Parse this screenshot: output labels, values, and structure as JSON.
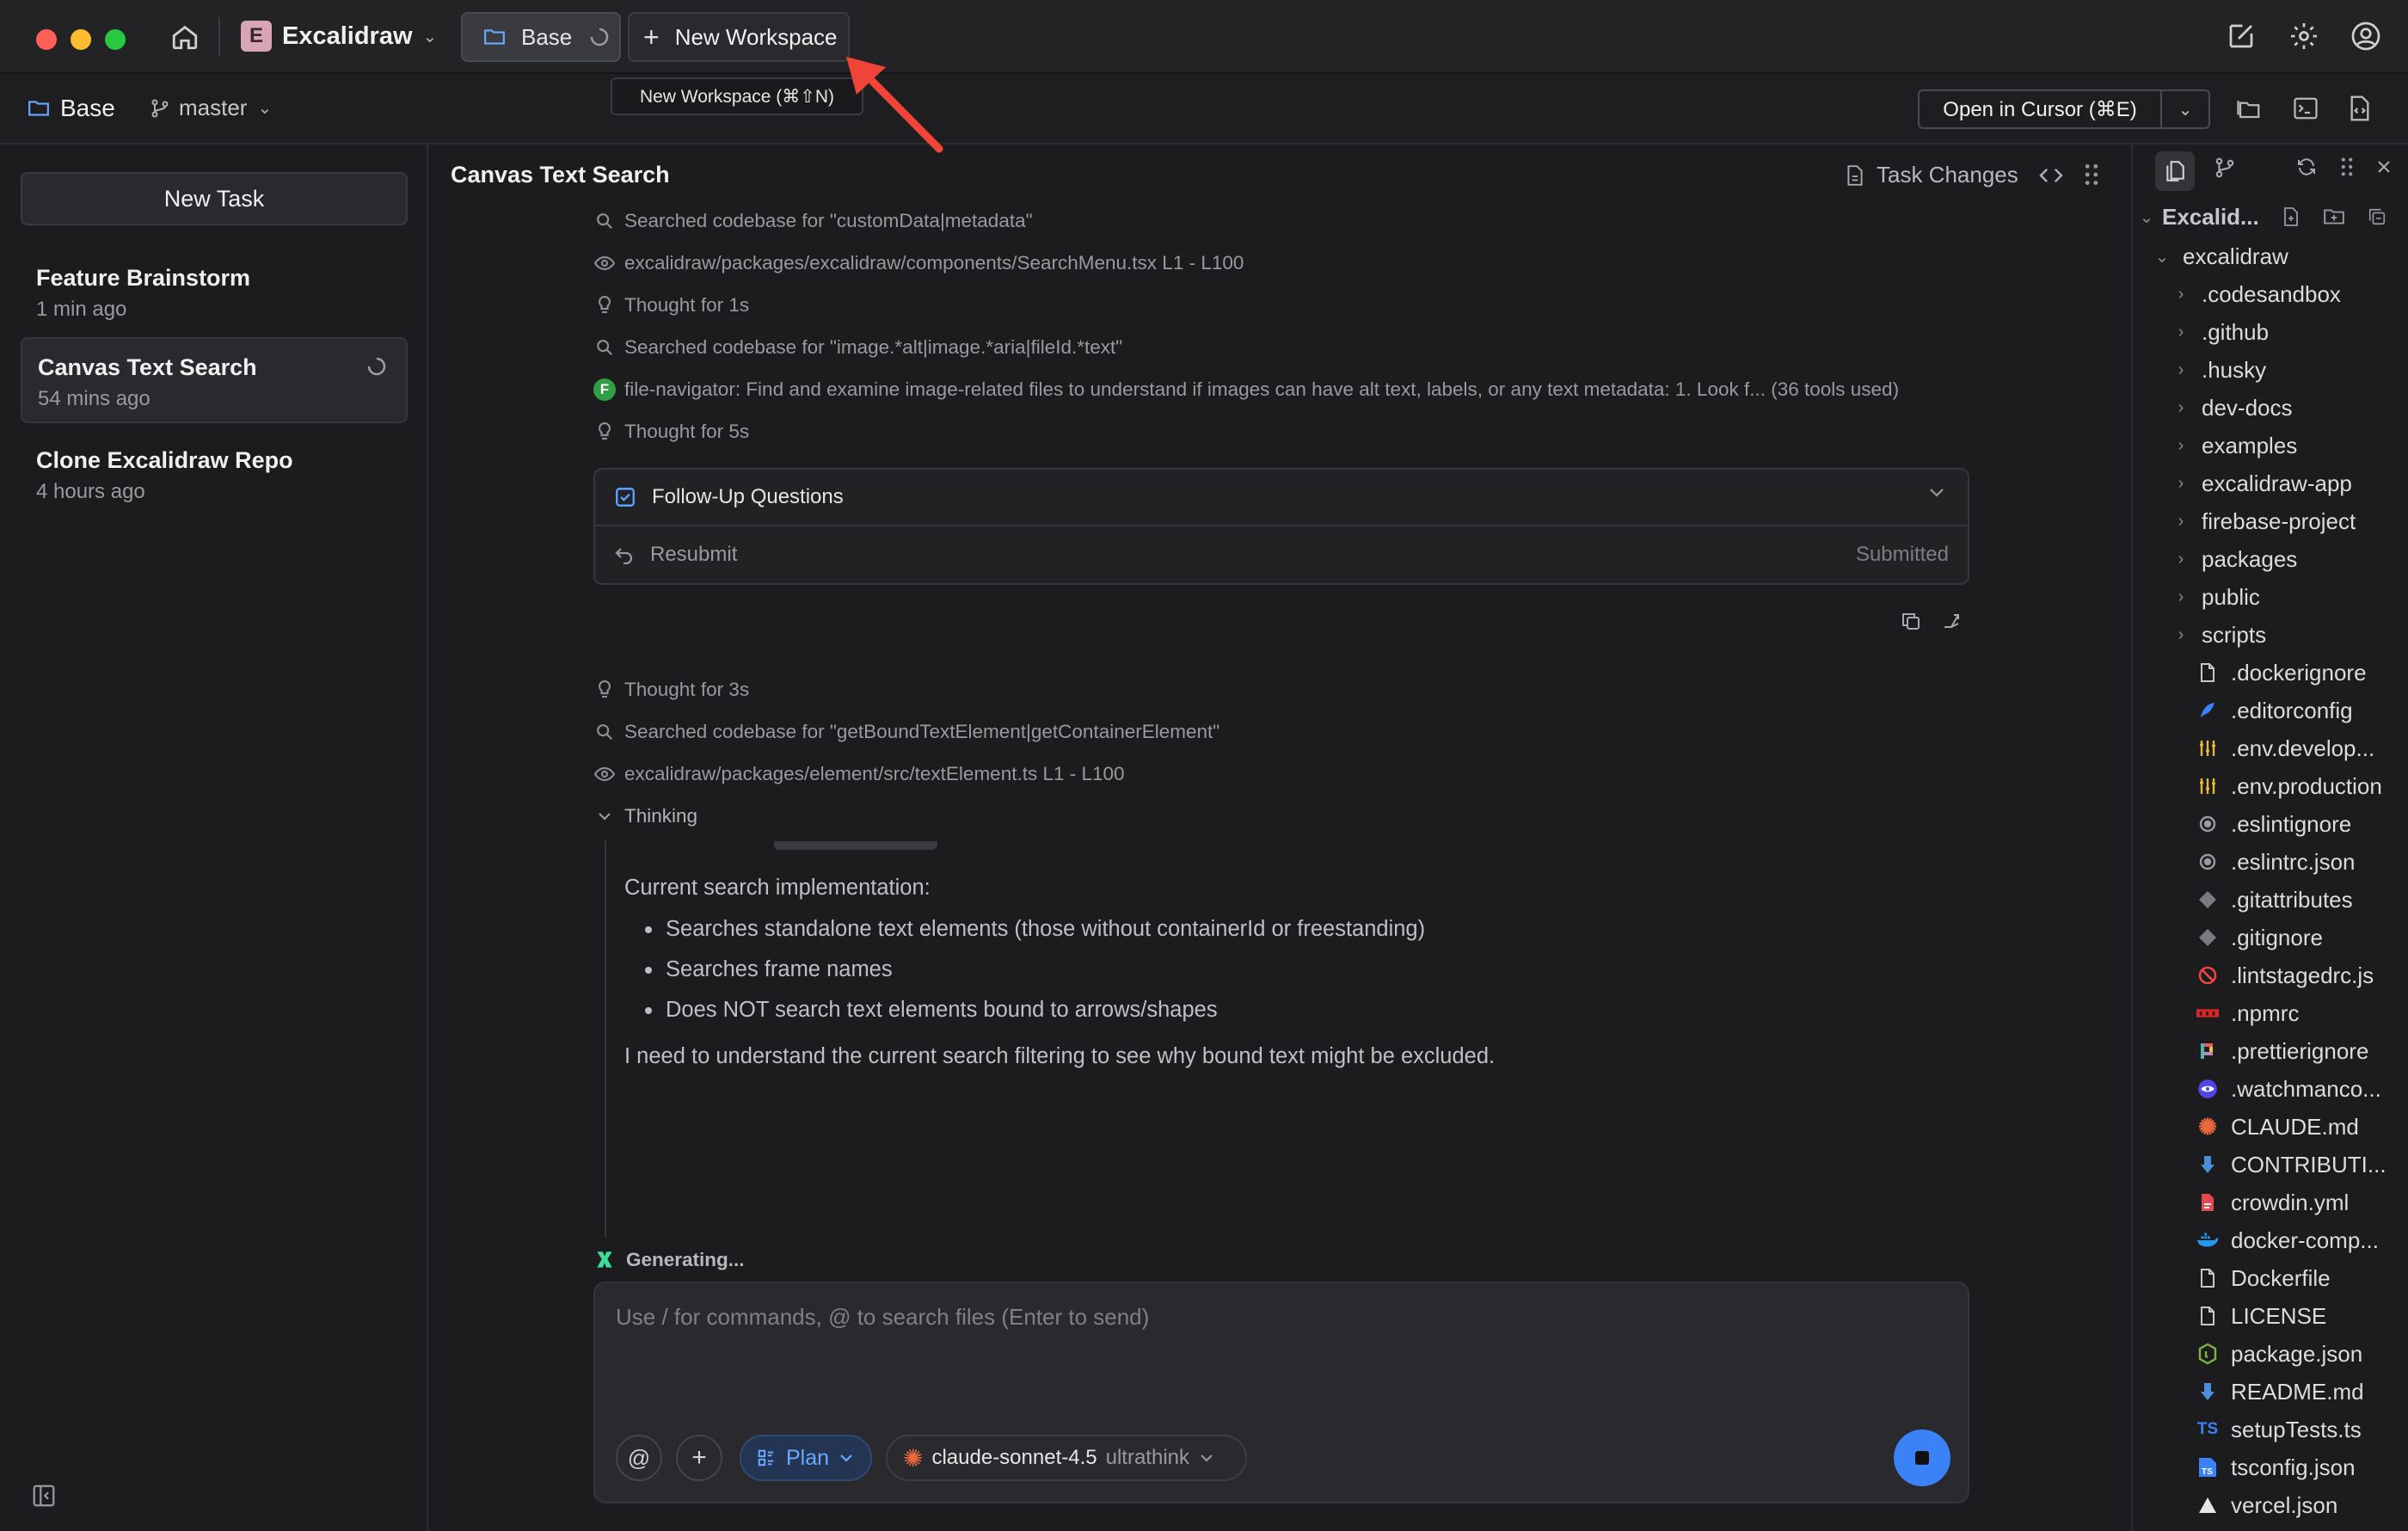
{
  "titlebar": {
    "app_name": "Excalidraw",
    "app_initial": "E",
    "tab_base": "Base",
    "new_workspace": "New Workspace",
    "tooltip": "New Workspace (⌘⇧N)"
  },
  "bar2": {
    "workspace": "Base",
    "branch": "master",
    "open_in_cursor": "Open in Cursor (⌘E)"
  },
  "sidebar": {
    "new_task": "New Task",
    "tasks": [
      {
        "title": "Feature Brainstorm",
        "time": "1 min ago"
      },
      {
        "title": "Canvas Text Search",
        "time": "54 mins ago"
      },
      {
        "title": "Clone Excalidraw Repo",
        "time": "4 hours ago"
      }
    ]
  },
  "main": {
    "title": "Canvas Text Search",
    "task_changes": "Task Changes",
    "lines_top": [
      "Searched codebase for \"customData|metadata\"",
      "excalidraw/packages/excalidraw/components/SearchMenu.tsx L1 - L100",
      "Thought for 1s",
      "Searched codebase for \"image.*alt|image.*aria|fileId.*text\"",
      "file-navigator: Find and examine image-related files to understand if images can have alt text, labels, or any text metadata: 1. Look f...  (36 tools used)",
      "Thought for 5s"
    ],
    "agent_badge": "F",
    "followup": "Follow-Up Questions",
    "resubmit": "Resubmit",
    "submitted": "Submitted",
    "lines_bottom": [
      "Thought for 3s",
      "Searched codebase for \"getBoundTextElement|getContainerElement\"",
      "excalidraw/packages/element/src/textElement.ts L1 - L100"
    ],
    "thinking": "Thinking",
    "thinking_heading": "Current search implementation:",
    "bullets": [
      "Searches standalone text elements (those without containerId or freestanding)",
      "Searches frame names",
      "Does NOT search text elements bound to arrows/shapes"
    ],
    "thinking_tail": "I need to understand the current search filtering to see why bound text might be excluded.",
    "generating": "Generating...",
    "input_placeholder": "Use / for commands, @ to search files (Enter to send)",
    "mode": "Plan",
    "model": "claude-sonnet-4.5",
    "model_suffix": "ultrathink"
  },
  "rpanel": {
    "project": "Excalid...",
    "root": "excalidraw",
    "folders": [
      ".codesandbox",
      ".github",
      ".husky",
      "dev-docs",
      "examples",
      "excalidraw-app",
      "firebase-project",
      "packages",
      "public",
      "scripts"
    ],
    "files": [
      {
        "name": ".dockerignore",
        "icon": "file-icon",
        "color": "#c8c8c8"
      },
      {
        "name": ".editorconfig",
        "icon": "editorconfig-icon",
        "color": "#3b82f6"
      },
      {
        "name": ".env.develop...",
        "icon": "env-icon",
        "color": "#e5b83b"
      },
      {
        "name": ".env.production",
        "icon": "env-icon",
        "color": "#e5b83b"
      },
      {
        "name": ".eslintignore",
        "icon": "eslint-icon",
        "color": "#9a9a9e"
      },
      {
        "name": ".eslintrc.json",
        "icon": "eslint-icon",
        "color": "#9a9a9e"
      },
      {
        "name": ".gitattributes",
        "icon": "git-icon",
        "color": "#7a7a80"
      },
      {
        "name": ".gitignore",
        "icon": "git-icon",
        "color": "#7a7a80"
      },
      {
        "name": ".lintstagedrc.js",
        "icon": "block-icon",
        "color": "#ef4444"
      },
      {
        "name": ".npmrc",
        "icon": "npm-icon",
        "color": "#dc2626"
      },
      {
        "name": ".prettierignore",
        "icon": "prettier-icon",
        "color": "#f59e0b"
      },
      {
        "name": ".watchmanco...",
        "icon": "watchman-icon",
        "color": "#4f46e5"
      },
      {
        "name": "CLAUDE.md",
        "icon": "claude-icon",
        "color": "#e8693c"
      },
      {
        "name": "CONTRIBUTI...",
        "icon": "markdown-icon",
        "color": "#4a90d9"
      },
      {
        "name": "crowdin.yml",
        "icon": "crowdin-icon",
        "color": "#e5484d"
      },
      {
        "name": "docker-comp...",
        "icon": "docker-icon",
        "color": "#2496ed"
      },
      {
        "name": "Dockerfile",
        "icon": "file-icon",
        "color": "#c8c8c8"
      },
      {
        "name": "LICENSE",
        "icon": "file-icon",
        "color": "#c8c8c8"
      },
      {
        "name": "package.json",
        "icon": "node-icon",
        "color": "#7cb342"
      },
      {
        "name": "README.md",
        "icon": "markdown-icon",
        "color": "#4a90d9"
      },
      {
        "name": "setupTests.ts",
        "icon": "ts-icon",
        "color": "#3b82f6"
      },
      {
        "name": "tsconfig.json",
        "icon": "tsconfig-icon",
        "color": "#3b82f6"
      },
      {
        "name": "vercel.json",
        "icon": "vercel-icon",
        "color": "#e6e6e6"
      }
    ]
  }
}
